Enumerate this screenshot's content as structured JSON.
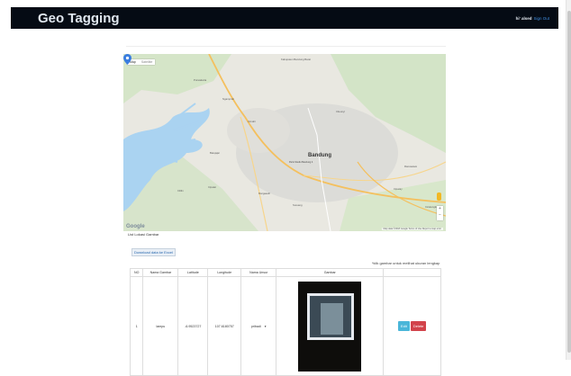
{
  "header": {
    "brand": "Geo Tagging",
    "greeting": "hi' alsed",
    "signout": "Sign Out"
  },
  "map": {
    "tab_map": "Map",
    "tab_satellite": "Satellite",
    "city": "Bandung",
    "city_sub": "Paris Studio Bandung 4",
    "places": [
      "Kabupaten Bandung Barat",
      "Purwakarta",
      "Ngamprah",
      "Cimahi",
      "Cileunyi",
      "Batujajar",
      "Cililin",
      "Cipatat",
      "Margaasih",
      "Soreang",
      "Ciparay",
      "Rancaekek",
      "Cicalengka"
    ],
    "zoom_in": "+",
    "zoom_out": "−",
    "google": "Google",
    "attribution": "Map data ©2018 Google   Terms of Use   Report a map error"
  },
  "list": {
    "title": "List Lokasi Gambar",
    "download_label": "Download data ke Excel",
    "hint": "*klik gambar untuk melihat ukuran lengkap"
  },
  "table": {
    "columns": [
      "NO",
      "Nama Gambar",
      "Latitude",
      "Longitude",
      "Nama Unsur",
      "Gambar",
      ""
    ],
    "rows": [
      {
        "no": "1",
        "nama": "lampu",
        "lat": "-6.9523727",
        "lng": "107.6180757",
        "unsur": "pribadi",
        "edit": "Edit",
        "delete": "Delete"
      }
    ]
  },
  "icons": {
    "pin": "map-pin-icon",
    "pegman": "pegman-icon",
    "dropdown": "chevron-down-icon"
  },
  "colors": {
    "header_bg": "#050b14",
    "edit": "#4ab6d9",
    "delete": "#d2434b",
    "water": "#aad3f1",
    "road": "#f4c05e",
    "pin": "#3a7de0"
  }
}
